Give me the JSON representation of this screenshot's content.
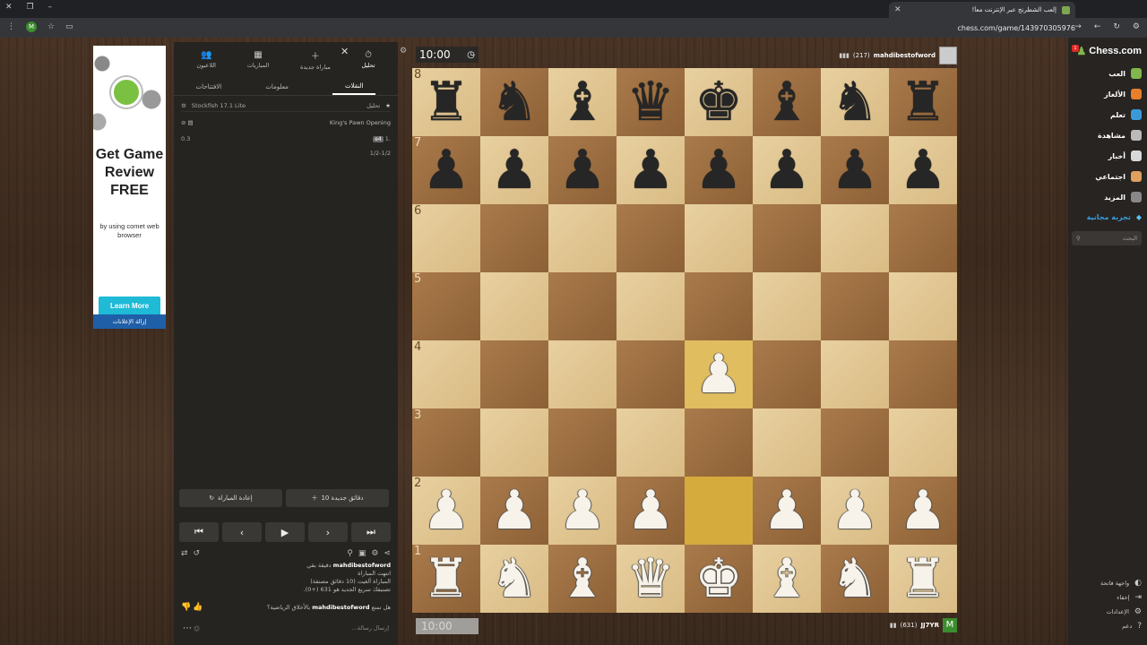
{
  "browser": {
    "tab_title": "إلعب الشطرنج عبر الإنترنت معاً!",
    "url": "chess.com/game/143970305976",
    "profile_initial": "M"
  },
  "ad": {
    "title": "Get Game Review FREE",
    "subtitle": "by using comet web browser",
    "button": "Learn More",
    "remove": "إزالة الإعلانات"
  },
  "panel": {
    "tabs": [
      {
        "label": "تحليل",
        "icon": "⏱"
      },
      {
        "label": "مباراة جديدة",
        "icon": "＋"
      },
      {
        "label": "المباريات",
        "icon": "▦"
      },
      {
        "label": "اللاعبون",
        "icon": "👥"
      }
    ],
    "subtabs": [
      "النقلات",
      "معلومات",
      "الافتتاحات"
    ],
    "analysis_label": "تحليل",
    "engine": "Stockfish 17.1 Lite",
    "opening": "King's Pawn Opening",
    "move_number": "1.",
    "move_white": "e4",
    "eval": "0.3",
    "result": "1/2-1/2",
    "rematch": "إعادة المباراة",
    "new_game": "10 دقائق جديدة",
    "chat": {
      "line1": "mahdibestofword",
      "line1_suffix": "دقيقة بقي",
      "line2": "انتهت المباراة",
      "line3": "المباراة ألغيت (10 دقائق مصنفة)",
      "line4": "تصنيفك سريع الجديد هو 631 (+0).",
      "question_pre": "هل تمتع",
      "question_name": "mahdibestofword",
      "question_post": "بالأخلاق الرياضية؟",
      "input_placeholder": "إرسال رسالة..."
    }
  },
  "game": {
    "top_clock": "10:00",
    "bottom_clock": "10:00",
    "top_player": {
      "name": "mahdibestofword",
      "rating": "(217)"
    },
    "bottom_player": {
      "name": "JJ7YR",
      "rating": "(631)",
      "avatar": "M"
    },
    "ranks": [
      "8",
      "7",
      "6",
      "5",
      "4",
      "3",
      "2",
      "1"
    ],
    "board": [
      [
        "r",
        "n",
        "b",
        "q",
        "k",
        "b",
        "n",
        "r"
      ],
      [
        "p",
        "p",
        "p",
        "p",
        "p",
        "p",
        "p",
        "p"
      ],
      [
        "",
        "",
        "",
        "",
        "",
        "",
        "",
        ""
      ],
      [
        "",
        "",
        "",
        "",
        "",
        "",
        "",
        ""
      ],
      [
        "",
        "",
        "",
        "",
        "P",
        "",
        "",
        ""
      ],
      [
        "",
        "",
        "",
        "",
        "",
        "",
        "",
        ""
      ],
      [
        "P",
        "P",
        "P",
        "P",
        "",
        "P",
        "P",
        "P"
      ],
      [
        "R",
        "N",
        "B",
        "Q",
        "K",
        "B",
        "N",
        "R"
      ]
    ],
    "highlight_from": "e2",
    "highlight_to": "e4"
  },
  "nav": {
    "logo": "Chess.com",
    "notifications": "1",
    "items": [
      {
        "label": "العب",
        "color": "#81b64c"
      },
      {
        "label": "الألغاز",
        "color": "#e8802b"
      },
      {
        "label": "تعلم",
        "color": "#3a9ad9"
      },
      {
        "label": "مشاهدة",
        "color": "#bbbbbb"
      },
      {
        "label": "أخبار",
        "color": "#d9d9d9"
      },
      {
        "label": "اجتماعي",
        "color": "#e0a060"
      },
      {
        "label": "المزيد",
        "color": "#888888"
      }
    ],
    "free_trial": "تجربة مجانية",
    "search_placeholder": "البحث",
    "bottom": [
      "واجهة فاتحة",
      "إخفاء",
      "الإعدادات",
      "دعم"
    ]
  }
}
